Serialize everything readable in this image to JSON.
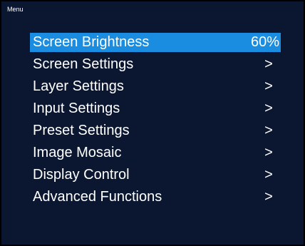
{
  "osd": {
    "title": "Menu",
    "background_color": "#0b1730",
    "highlight_color": "#1a8de0"
  },
  "menu": {
    "items": [
      {
        "label": "Screen Brightness",
        "value": "60%",
        "selected": true
      },
      {
        "label": "Screen Settings",
        "value": ">",
        "selected": false
      },
      {
        "label": "Layer Settings",
        "value": ">",
        "selected": false
      },
      {
        "label": "Input Settings",
        "value": ">",
        "selected": false
      },
      {
        "label": "Preset Settings",
        "value": ">",
        "selected": false
      },
      {
        "label": "Image Mosaic",
        "value": ">",
        "selected": false
      },
      {
        "label": "Display Control",
        "value": ">",
        "selected": false
      },
      {
        "label": "Advanced Functions",
        "value": ">",
        "selected": false
      }
    ]
  }
}
